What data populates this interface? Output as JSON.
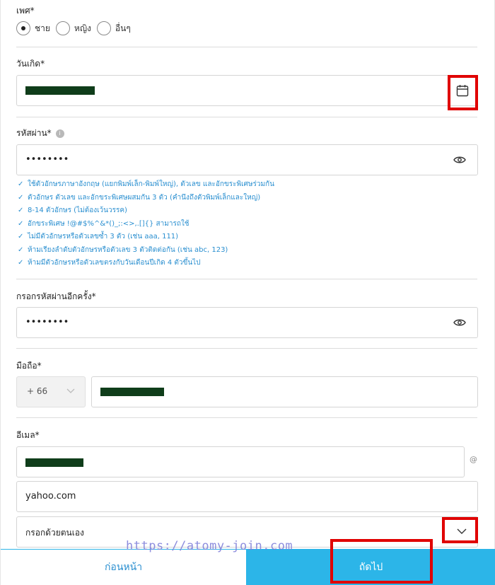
{
  "gender": {
    "label": "เพศ*",
    "options": [
      {
        "label": "ชาย",
        "checked": true
      },
      {
        "label": "หญิง",
        "checked": false
      },
      {
        "label": "อื่นๆ",
        "checked": false
      }
    ]
  },
  "birthday": {
    "label": "วันเกิด*",
    "value": "",
    "icon": "calendar-icon"
  },
  "password": {
    "label": "รหัสผ่าน*",
    "value": "••••••••",
    "icon": "eye-icon",
    "rules": [
      "ใช้ตัวอักษรภาษาอังกฤษ (แยกพิมพ์เล็ก-พิมพ์ใหญ่), ตัวเลข และอักขระพิเศษร่วมกัน",
      "ตัวอักษร ตัวเลข และอักขระพิเศษผสมกัน 3 ตัว (คำนึงถึงตัวพิมพ์เล็กและใหญ่)",
      "8-14 ตัวอักษร (ไม่ต้องเว้นวรรค)",
      "อักขระพิเศษ !@#$%^&*()_;:<>,.[]{} สามารถใช้",
      "ไม่มีตัวอักษรหรือตัวเลขซ้ำ 3 ตัว (เช่น aaa, 111)",
      "ห้ามเรียงลำดับตัวอักษรหรือตัวเลข 3 ตัวติดต่อกัน (เช่น abc, 123)",
      "ห้ามมีตัวอักษรหรือตัวเลขตรงกับวันเดือนปีเกิด 4 ตัวขึ้นไป"
    ]
  },
  "password_confirm": {
    "label": "กรอกรหัสผ่านอีกครั้ง*",
    "value": "••••••••"
  },
  "mobile": {
    "label": "มือถือ*",
    "country_code": "+ 66",
    "value": ""
  },
  "email": {
    "label": "อีเมล*",
    "local_value": "",
    "at_symbol": "@",
    "domain_value": "yahoo.com",
    "domain_select": "กรอกด้วยตนเอง"
  },
  "footer": {
    "prev_label": "ก่อนหน้า",
    "next_label": "ถัดไป"
  },
  "watermark": "https://atomy-join.com",
  "colors": {
    "accent": "#2cb5e8",
    "rule_text": "#2a8fd0",
    "highlight": "#e00000"
  }
}
